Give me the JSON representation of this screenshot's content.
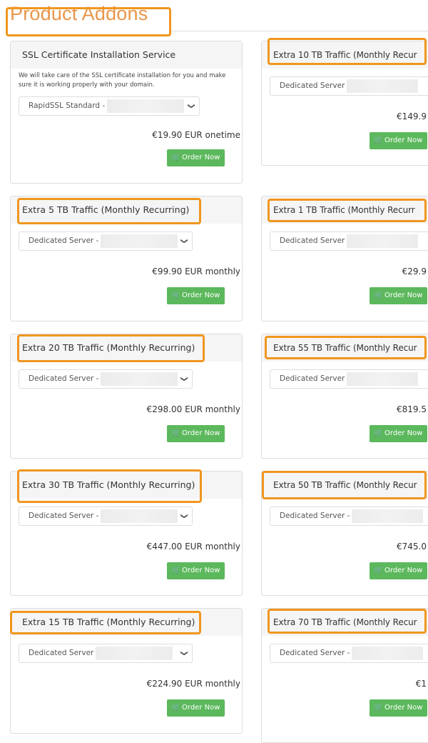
{
  "page": {
    "title": "Product Addons"
  },
  "colors": {
    "accent": "#e8964a",
    "highlight": "#f0961e",
    "button": "#5cb85c"
  },
  "addons": {
    "left": [
      {
        "title": "SSL Certificate Installation Service",
        "description": "We will take care of the SSL certificate installation for you and make sure it is working properly with your domain.",
        "select": "RapidSSL Standard -",
        "price": "€19.90 EUR onetime",
        "button": "Order Now",
        "icon": "cart-icon"
      },
      {
        "title": "Extra 5 TB Traffic (Monthly Recurring)",
        "select": "Dedicated Server -",
        "price": "€99.90 EUR monthly",
        "button": "Order Now",
        "icon": "cart-icon"
      },
      {
        "title": "Extra 20 TB Traffic (Monthly Recurring)",
        "select": "Dedicated Server -",
        "price": "€298.00 EUR monthly",
        "button": "Order Now",
        "icon": "cart-icon"
      },
      {
        "title": "Extra 30 TB Traffic (Monthly Recurring)",
        "select": "Dedicated Server -",
        "price": "€447.00 EUR monthly",
        "button": "Order Now",
        "icon": "cart-icon"
      },
      {
        "title": "Extra 15 TB Traffic (Monthly Recurring)",
        "select": "Dedicated Server",
        "price": "€224.90 EUR monthly",
        "button": "Order Now",
        "icon": "cart-icon"
      }
    ],
    "right": [
      {
        "title": "Extra 10 TB Traffic (Monthly Recur",
        "select": "Dedicated Server",
        "price": "€149.9",
        "button": "Order Now"
      },
      {
        "title": "Extra 1 TB Traffic (Monthly Recurr",
        "select": "Dedicated Server",
        "price": "€29.9",
        "button": "Order Now"
      },
      {
        "title": "Extra 55 TB Traffic (Monthly Recur",
        "select": "Dedicated Server",
        "price": "€819.5",
        "button": "Order Now"
      },
      {
        "title": "Extra 50 TB Traffic (Monthly Recur",
        "select": "Dedicated Server -",
        "price": "€745.0",
        "button": "Order Now"
      },
      {
        "title": "Extra 70 TB Traffic (Monthly Recur",
        "select": "Dedicated Server -",
        "price": "€1",
        "button": "Order Now"
      }
    ]
  }
}
